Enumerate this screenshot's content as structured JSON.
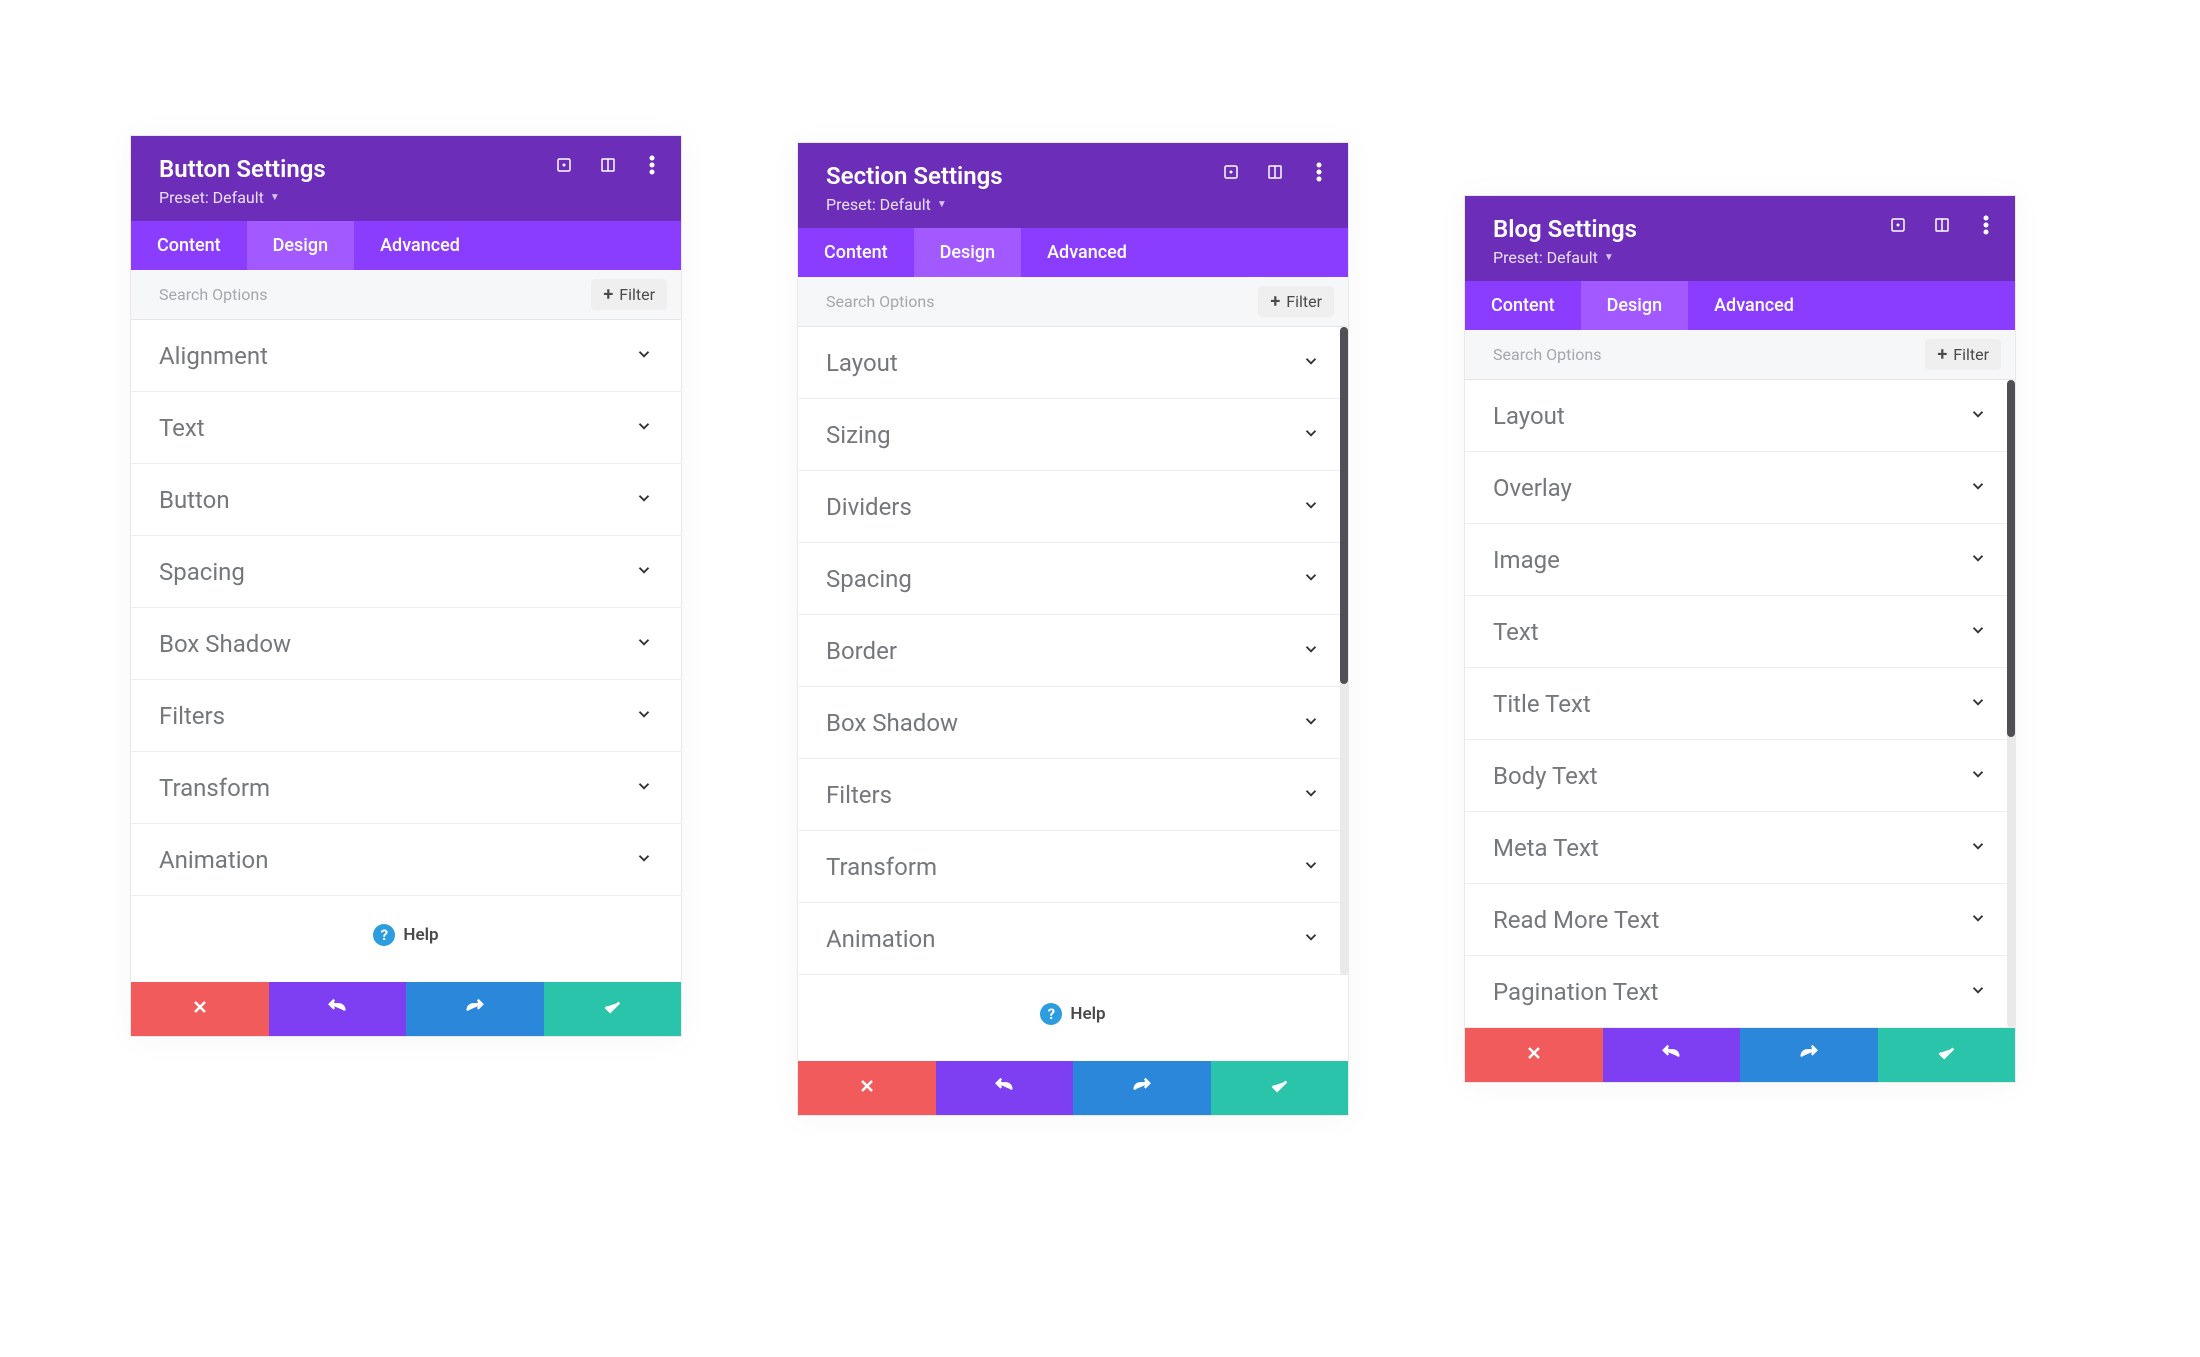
{
  "ui": {
    "search_placeholder": "Search Options",
    "filter_label": "Filter",
    "help_label": "Help",
    "tabs": {
      "content": "Content",
      "design": "Design",
      "advanced": "Advanced"
    },
    "preset_label": "Preset: Default"
  },
  "panels": [
    {
      "title": "Button Settings",
      "options": [
        "Alignment",
        "Text",
        "Button",
        "Spacing",
        "Box Shadow",
        "Filters",
        "Transform",
        "Animation"
      ],
      "scrollbar": false,
      "show_help": true
    },
    {
      "title": "Section Settings",
      "options": [
        "Layout",
        "Sizing",
        "Dividers",
        "Spacing",
        "Border",
        "Box Shadow",
        "Filters",
        "Transform",
        "Animation"
      ],
      "scrollbar": true,
      "show_help": true
    },
    {
      "title": "Blog Settings",
      "options": [
        "Layout",
        "Overlay",
        "Image",
        "Text",
        "Title Text",
        "Body Text",
        "Meta Text",
        "Read More Text",
        "Pagination Text"
      ],
      "scrollbar": true,
      "show_help": false
    }
  ]
}
